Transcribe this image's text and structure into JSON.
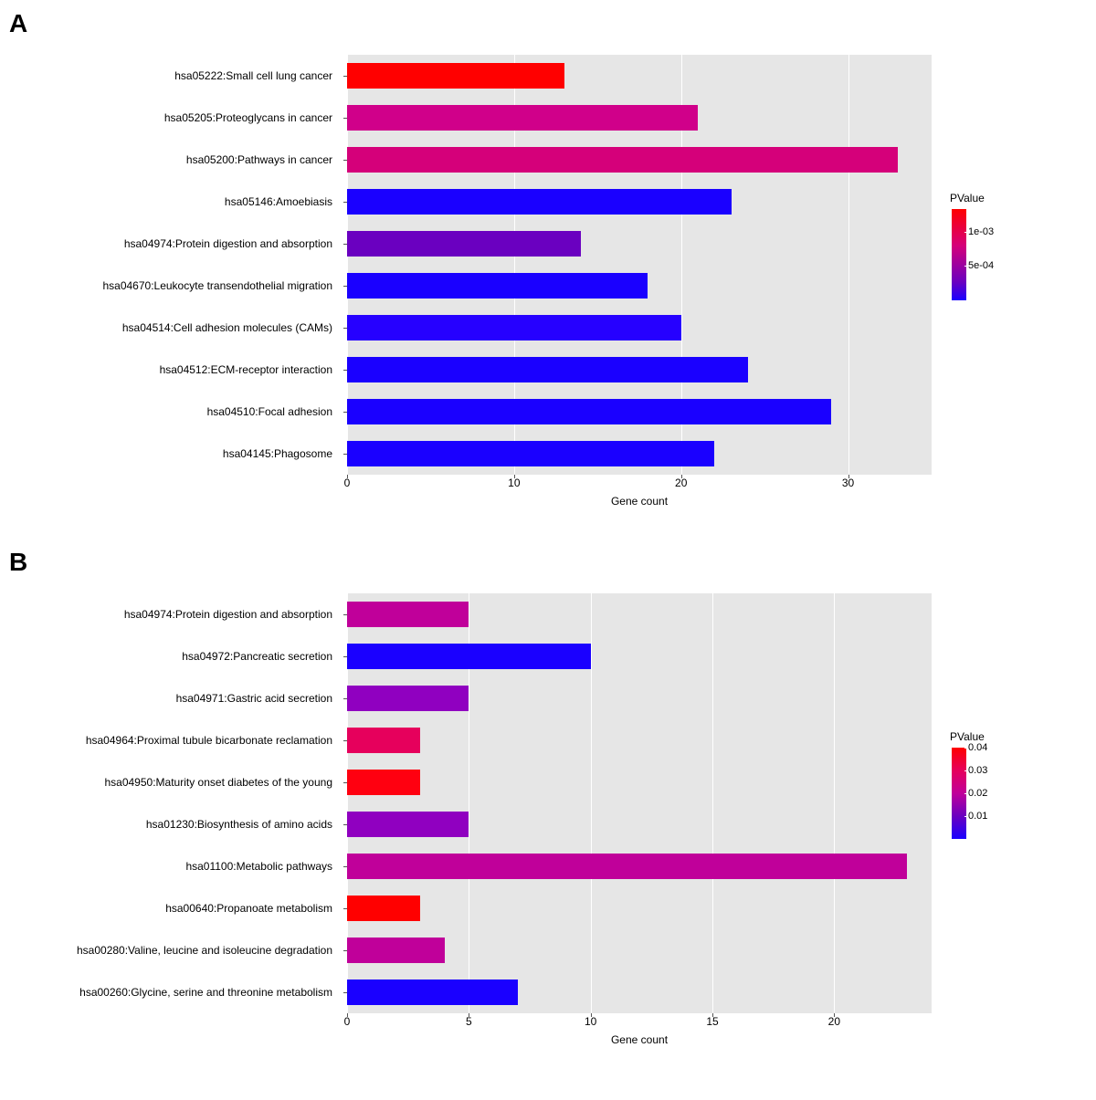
{
  "chart_data": [
    {
      "panel": "A",
      "type": "bar",
      "xlabel": "Gene count",
      "ylabel": "",
      "xlim": [
        0,
        35
      ],
      "xticks": [
        0,
        10,
        20,
        30
      ],
      "legend_title": "PValue",
      "legend_range": [
        1e-05,
        0.0013
      ],
      "legend_ticks": [
        {
          "label": "1e-03",
          "frac": 0.25
        },
        {
          "label": "5e-04",
          "frac": 0.62
        }
      ],
      "categories": [
        "hsa05222:Small cell lung cancer",
        "hsa05205:Proteoglycans in cancer",
        "hsa05200:Pathways in cancer",
        "hsa05146:Amoebiasis",
        "hsa04974:Protein digestion and absorption",
        "hsa04670:Leukocyte transendothelial migration",
        "hsa04514:Cell adhesion molecules (CAMs)",
        "hsa04512:ECM-receptor interaction",
        "hsa04510:Focal adhesion",
        "hsa04145:Phagosome"
      ],
      "values": [
        13,
        21,
        33,
        23,
        14,
        18,
        20,
        24,
        29,
        22
      ],
      "pvalue_color": [
        "#ff0000",
        "#d0008a",
        "#d5007a",
        "#1a00ff",
        "#6a00c0",
        "#1a00ff",
        "#2600ff",
        "#1a00ff",
        "#1a00ff",
        "#1a00ff"
      ]
    },
    {
      "panel": "B",
      "type": "bar",
      "xlabel": "Gene count",
      "ylabel": "",
      "xlim": [
        0,
        24
      ],
      "xticks": [
        0,
        5,
        10,
        15,
        20
      ],
      "legend_title": "PValue",
      "legend_range": [
        0.0001,
        0.04
      ],
      "legend_ticks": [
        {
          "label": "0.04",
          "frac": 0.0
        },
        {
          "label": "0.03",
          "frac": 0.25
        },
        {
          "label": "0.02",
          "frac": 0.5
        },
        {
          "label": "0.01",
          "frac": 0.75
        }
      ],
      "categories": [
        "hsa04974:Protein digestion and absorption",
        "hsa04972:Pancreatic secretion",
        "hsa04971:Gastric acid secretion",
        "hsa04964:Proximal tubule bicarbonate reclamation",
        "hsa04950:Maturity onset diabetes of the young",
        "hsa01230:Biosynthesis of amino acids",
        "hsa01100:Metabolic pathways",
        "hsa00640:Propanoate metabolism",
        "hsa00280:Valine, leucine and isoleucine degradation",
        "hsa00260:Glycine, serine and threonine metabolism"
      ],
      "values": [
        5,
        10,
        5,
        3,
        3,
        5,
        23,
        3,
        4,
        7
      ],
      "pvalue_color": [
        "#c0009a",
        "#1a00ff",
        "#9000c0",
        "#e6005c",
        "#ff0010",
        "#9000c0",
        "#c0009a",
        "#ff0000",
        "#c0009a",
        "#1a00ff"
      ]
    }
  ]
}
